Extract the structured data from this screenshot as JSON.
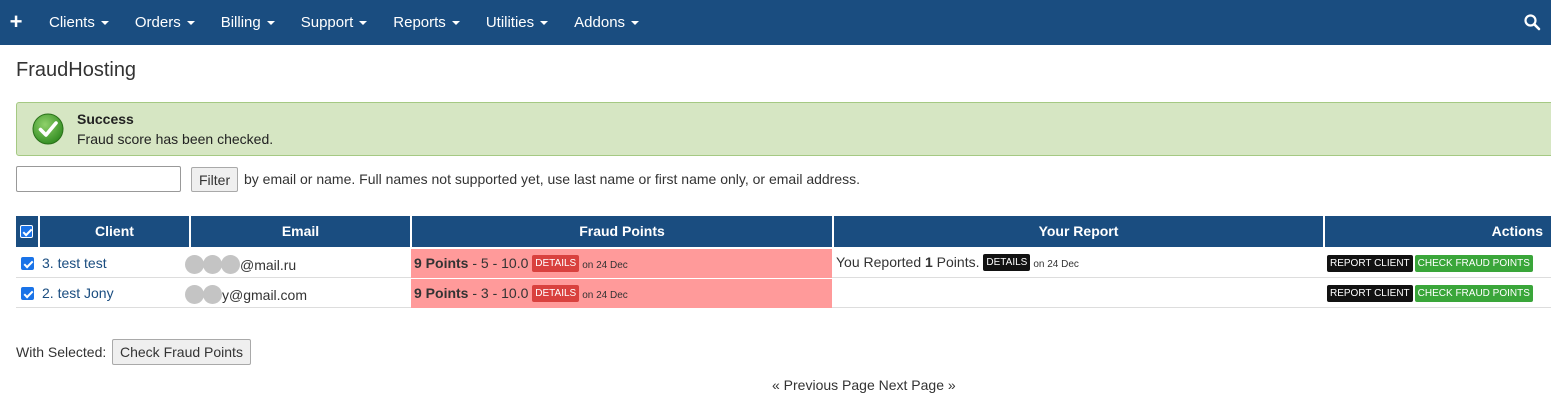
{
  "nav": {
    "items": [
      {
        "label": "Clients"
      },
      {
        "label": "Orders"
      },
      {
        "label": "Billing"
      },
      {
        "label": "Support"
      },
      {
        "label": "Reports"
      },
      {
        "label": "Utilities"
      },
      {
        "label": "Addons"
      }
    ],
    "plus_icon": "plus-icon",
    "search_icon": "search-icon",
    "bg_color": "#1a4d80"
  },
  "page": {
    "title": "FraudHosting"
  },
  "alert": {
    "title": "Success",
    "message": "Fraud score has been checked.",
    "icon": "check-circle-icon",
    "bg_color": "#d6e6c3"
  },
  "filter": {
    "input_value": "",
    "button_label": "Filter",
    "help_text": "by email or name. Full names not supported yet, use last name or first name only, or email address."
  },
  "table": {
    "headers": {
      "client": "Client",
      "email": "Email",
      "fraud_points": "Fraud Points",
      "your_report": "Your Report",
      "actions": "Actions"
    },
    "rows": [
      {
        "checked": true,
        "client": "3. test test",
        "email": "@mail.ru",
        "fraud_points": "9 Points",
        "fraud_detail": " - 5 - 10.0 ",
        "details_label": "DETAILS",
        "fraud_date": "on 24 Dec",
        "report_prefix": "You Reported ",
        "report_points": "1",
        "report_suffix": " Points. ",
        "report_details_label": "DETAILS",
        "report_date": "on 24 Dec",
        "report_button": "REPORT CLIENT",
        "check_button": "CHECK FRAUD POINTS"
      },
      {
        "checked": true,
        "client": "2. test Jony",
        "email": "y@gmail.com",
        "fraud_points": "9 Points",
        "fraud_detail": " - 3 - 10.0 ",
        "details_label": "DETAILS",
        "fraud_date": "on 24 Dec",
        "report_button": "REPORT CLIENT",
        "check_button": "CHECK FRAUD POINTS"
      }
    ]
  },
  "bulk": {
    "label": "With Selected:",
    "button_label": "Check Fraud Points"
  },
  "pagination": {
    "previous": "« Previous Page",
    "next": "Next Page »"
  }
}
